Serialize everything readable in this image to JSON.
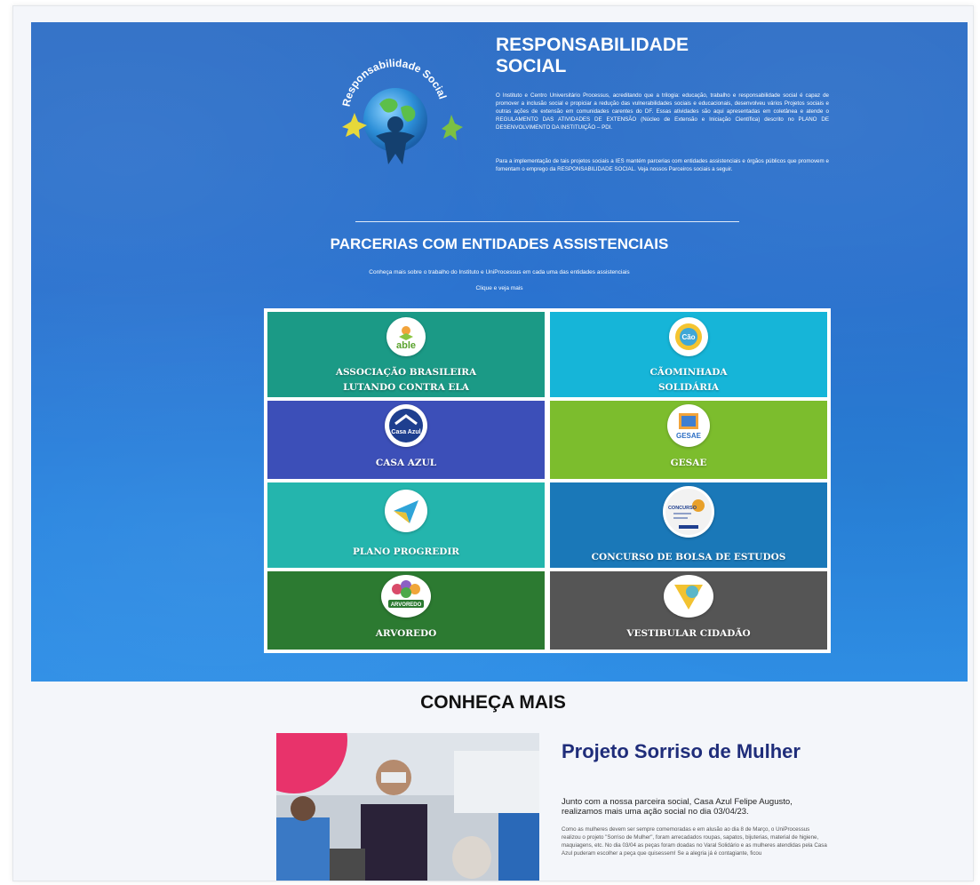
{
  "colors": {
    "hero_blue": "#2f6fc6",
    "teal": "#1b9a86",
    "cyan": "#16b5d8",
    "indigo": "#3c4fb8",
    "lime": "#7cbd2d",
    "teal_light": "#24b5ad",
    "blue_dark": "#1a78b8",
    "green_dark": "#2c7a31",
    "gray_dark": "#555555",
    "title_navy": "#1f2d7a"
  },
  "responsabilidade": {
    "logo_text": "Responsabilidade Social",
    "title": "RESPONSABILIDADE SOCIAL",
    "paragraph1": "O Instituto e Centro Universitário Processus, acreditando que a trilogia: educação, trabalho e responsabilidade social é capaz de promover a inclusão social e propiciar a redução das vulnerabilidades sociais e educacionais, desenvolveu vários Projetos sociais e outras ações de extensão em comunidades carentes do DF. Essas atividades são aqui apresentadas em coletânea e atende o REGULAMENTO DAS ATIVIDADES DE EXTENSÃO (Núcleo de Extensão e Iniciação Científica) descrito no PLANO DE DESENVOLVIMENTO DA INSTITUIÇÃO – PDI.",
    "paragraph2": "Para a implementação de tais projetos sociais a IES mantém parcerias com entidades assistenciais e órgãos públicos que promovem e fomentam o emprego da RESPONSABILIDADE SOCIAL. Veja nossos Parceiros sociais a seguir."
  },
  "parcerias": {
    "title": "PARCERIAS COM ENTIDADES ASSISTENCIAIS",
    "subtitle": "Conheça mais sobre o trabalho do Instituto e UniProcessus em cada uma das entidades assistenciais",
    "cta": "Clique e veja mais",
    "cards": [
      {
        "line1": "ASSOCIAÇÃO BRASILEIRA",
        "line2": "LUTANDO CONTRA ELA",
        "icon": "able-logo-icon",
        "icon_text": "able"
      },
      {
        "line1": "CÃOMINHADA",
        "line2": "SOLIDÁRIA",
        "icon": "caominhada-logo-icon",
        "icon_text": "Cão"
      },
      {
        "line1": "CASA AZUL",
        "line2": "",
        "icon": "casa-azul-logo-icon",
        "icon_text": "Casa Azul"
      },
      {
        "line1": "GESAE",
        "line2": "",
        "icon": "gesae-logo-icon",
        "icon_text": "GESAE"
      },
      {
        "line1": "PLANO PROGREDIR",
        "line2": "",
        "icon": "progredir-logo-icon",
        "icon_text": ""
      },
      {
        "line1": "CONCURSO DE BOLSA DE ESTUDOS",
        "line2": "",
        "icon": "concurso-logo-icon",
        "icon_text": "CONCURSO"
      },
      {
        "line1": "ARVOREDO",
        "line2": "",
        "icon": "arvoredo-logo-icon",
        "icon_text": "ARVOREDO"
      },
      {
        "line1": "VESTIBULAR CIDADÃO",
        "line2": "",
        "icon": "vestibular-logo-icon",
        "icon_text": ""
      }
    ]
  },
  "conheca": {
    "title": "CONHEÇA MAIS",
    "article_title": "Projeto Sorriso de Mulher",
    "article_lead": "Junto com a nossa parceira social, Casa Azul Felipe Augusto, realizamos mais uma ação social no dia 03/04/23.",
    "article_body": "Como as mulheres devem ser sempre comemoradas e em alusão ao dia 8 de Março, o UniProcessus realizou o projeto \"Sorriso de Mulher\", foram arrecadados roupas, sapatos, bijuterias, material de higiene, maquiagens, etc. No dia 03/04 as peças foram doadas no Varal Solidário e as mulheres atendidas pela Casa Azul puderam escolher a peça que quisessem! Se a alegria já é contagiante, ficou"
  }
}
